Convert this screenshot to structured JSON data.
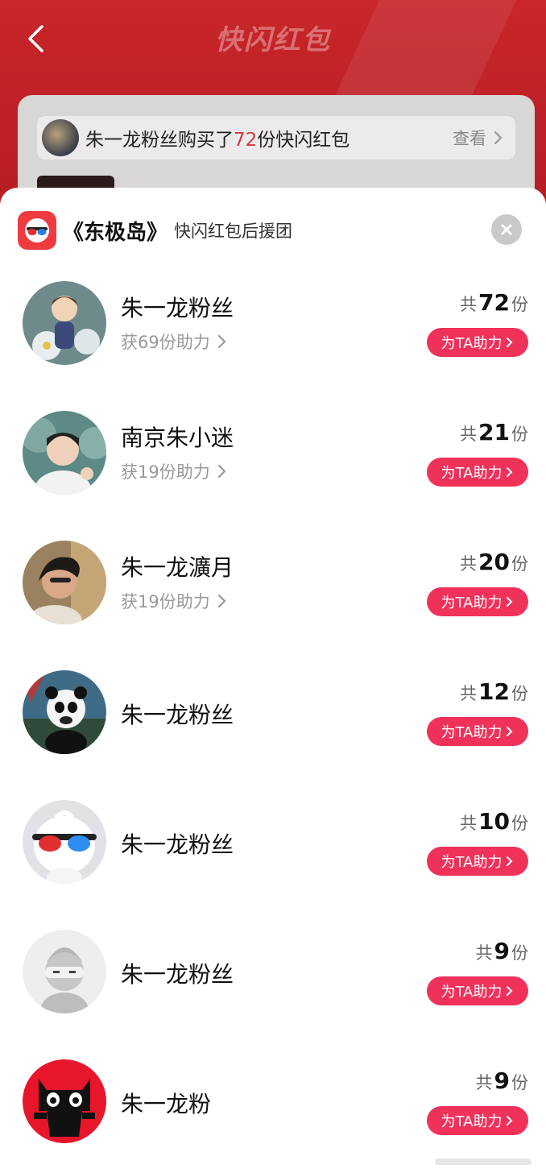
{
  "header": {
    "title": "快闪红包",
    "buy_notice_prefix": "朱一龙粉丝购买了",
    "buy_notice_count": "72",
    "buy_notice_suffix": "份快闪红包",
    "view_label": "查看"
  },
  "sheet": {
    "title": "《东极岛》",
    "subtitle": "快闪红包后援团"
  },
  "colors": {
    "accent": "#f0325a",
    "header_red": "#c8262a",
    "app_icon_red": "#ee3b3f"
  },
  "fans": [
    {
      "name": "朱一龙粉丝",
      "sub": "获69份助力",
      "count_prefix": "共",
      "count": "72",
      "count_unit": "份",
      "button": "为TA助力",
      "avatar": "anime-boy-flowers-avatar"
    },
    {
      "name": "南京朱小迷",
      "sub": "获19份助力",
      "count_prefix": "共",
      "count": "21",
      "count_unit": "份",
      "button": "为TA助力",
      "avatar": "smiling-man-photo-avatar"
    },
    {
      "name": "朱一龙瀇月",
      "sub": "获19份助力",
      "count_prefix": "共",
      "count": "20",
      "count_unit": "份",
      "button": "为TA助力",
      "avatar": "man-portrait-photo-avatar"
    },
    {
      "name": "朱一龙粉丝",
      "sub": "",
      "count_prefix": "共",
      "count": "12",
      "count_unit": "份",
      "button": "为TA助力",
      "avatar": "panda-avatar"
    },
    {
      "name": "朱一龙粉丝",
      "sub": "",
      "count_prefix": "共",
      "count": "10",
      "count_unit": "份",
      "button": "为TA助力",
      "avatar": "3d-glasses-mascot-avatar"
    },
    {
      "name": "朱一龙粉丝",
      "sub": "",
      "count_prefix": "共",
      "count": "9",
      "count_unit": "份",
      "button": "为TA助力",
      "avatar": "default-ninja-avatar"
    },
    {
      "name": "朱一龙粉",
      "sub": "",
      "count_prefix": "共",
      "count": "9",
      "count_unit": "份",
      "button": "为TA助力",
      "avatar": "tmall-cat-avatar"
    }
  ]
}
